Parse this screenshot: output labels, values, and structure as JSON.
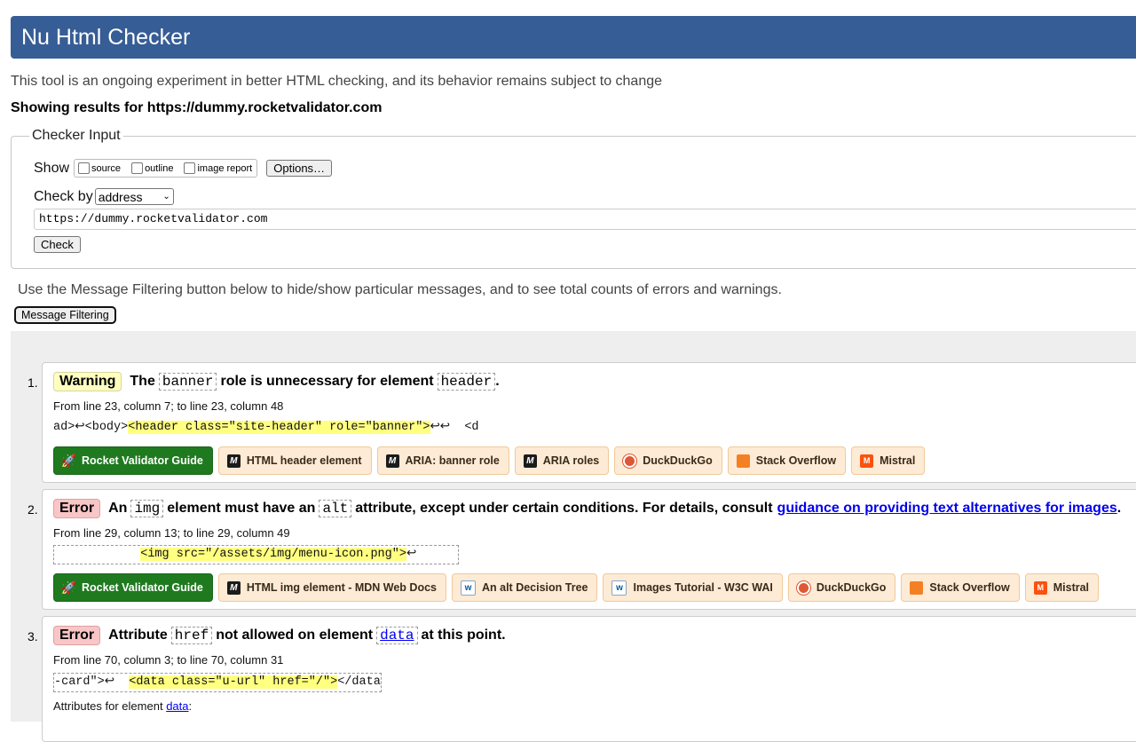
{
  "header": {
    "title": "Nu Html Checker"
  },
  "intro": "This tool is an ongoing experiment in better HTML checking, and its behavior remains subject to change",
  "showing_results": "Showing results for https://dummy.rocketvalidator.com",
  "checker_input": {
    "legend": "Checker Input",
    "show_label": "Show",
    "options": [
      {
        "label": "source",
        "checked": false
      },
      {
        "label": "outline",
        "checked": false
      },
      {
        "label": "image report",
        "checked": false
      }
    ],
    "options_button": "Options…",
    "check_by_label": "Check by",
    "check_by_value": "address",
    "url_value": "https://dummy.rocketvalidator.com",
    "check_button": "Check"
  },
  "filter": {
    "note": "Use the Message Filtering button below to hide/show particular messages, and to see total counts of errors and warnings.",
    "button": "Message Filtering"
  },
  "messages": [
    {
      "number": "1.",
      "type": "Warning",
      "parts": {
        "a": "The",
        "code1": "banner",
        "b": "role is unnecessary for element",
        "code2": "header",
        "c": "."
      },
      "location": "From line 23, column 7; to line 23, column 48",
      "extract_pre": "ad>↩<body>",
      "extract_hl": "<header class=\"site-header\" role=\"banner\">",
      "extract_post": "↩↩  <d",
      "links": [
        "Rocket Validator Guide",
        "HTML header element",
        "ARIA: banner role",
        "ARIA roles",
        "DuckDuckGo",
        "Stack Overflow",
        "Mistral"
      ]
    },
    {
      "number": "2.",
      "type": "Error",
      "parts": {
        "a": "An",
        "code1": "img",
        "b": "element must have an",
        "code2": "alt",
        "c": "attribute, except under certain conditions. For details, consult",
        "link": "guidance on providing text alternatives for images",
        "d": "."
      },
      "location": "From line 29, column 13; to line 29, column 49",
      "extract_pre": "            ",
      "extract_hl": "<img src=\"/assets/img/menu-icon.png\">",
      "extract_post": "↩",
      "links": [
        "Rocket Validator Guide",
        "HTML img element - MDN Web Docs",
        "An alt Decision Tree",
        "Images Tutorial - W3C WAI",
        "DuckDuckGo",
        "Stack Overflow",
        "Mistral"
      ]
    },
    {
      "number": "3.",
      "type": "Error",
      "parts": {
        "a": "Attribute",
        "code1": "href",
        "b": "not allowed on element",
        "code2": "data",
        "c": "at this point."
      },
      "location": "From line 70, column 3; to line 70, column 31",
      "extract_pre": "-card\">↩  ",
      "extract_hl": "<data class=\"u-url\" href=\"/\">",
      "extract_post": "</data",
      "attributes_label": "Attributes for element",
      "attributes_element": "data",
      "attributes_colon": ":"
    }
  ],
  "colors": {
    "banner": "#365d95",
    "warning_badge": "#ffffc0",
    "error_badge": "#f8c6c6",
    "guide_button": "#1f7a1f",
    "link_button": "#fdebd6",
    "highlight": "#ffff80"
  }
}
